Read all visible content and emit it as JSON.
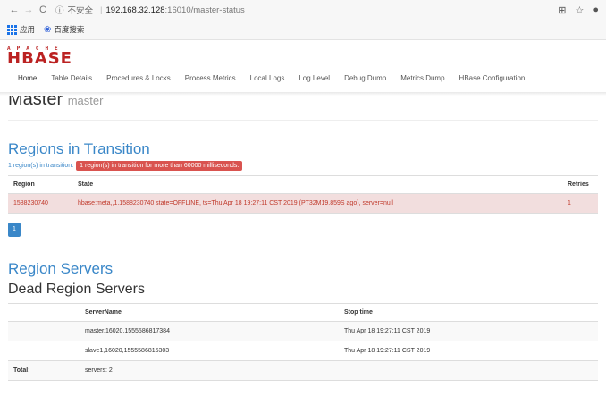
{
  "browser": {
    "insecure_label": "不安全",
    "url_host": "192.168.32.128",
    "url_path": ":16010/master-status",
    "bookmarks": [
      "应用",
      "百度搜索"
    ]
  },
  "header": {
    "logo_top": "APACHE",
    "logo_main": "HBASE",
    "nav": [
      "Home",
      "Table Details",
      "Procedures & Locks",
      "Process Metrics",
      "Local Logs",
      "Log Level",
      "Debug Dump",
      "Metrics Dump",
      "HBase Configuration"
    ]
  },
  "master": {
    "title": "Master",
    "subtitle": "master"
  },
  "rit": {
    "heading": "Regions in Transition",
    "count_text": "1 region(s) in transition.",
    "badge_text": "1 region(s) in transition for more than 60000 milliseconds.",
    "columns": [
      "Region",
      "State",
      "Retries"
    ],
    "rows": [
      {
        "region": "1588230740",
        "state": "hbase:meta,,1.1588230740 state=OFFLINE, ts=Thu Apr 18 19:27:11 CST 2019 (PT32M19.859S ago), server=null",
        "retries": "1"
      }
    ],
    "page": "1"
  },
  "region_servers": {
    "heading": "Region Servers",
    "dead_heading": "Dead Region Servers",
    "columns": [
      "",
      "ServerName",
      "Stop time"
    ],
    "rows": [
      {
        "name": "master,16020,1555586817384",
        "stop": "Thu Apr 18 19:27:11 CST 2019"
      },
      {
        "name": "slave1,16020,1555586815303",
        "stop": "Thu Apr 18 19:27:11 CST 2019"
      }
    ],
    "total_label": "Total:",
    "total_value": "servers: 2"
  }
}
